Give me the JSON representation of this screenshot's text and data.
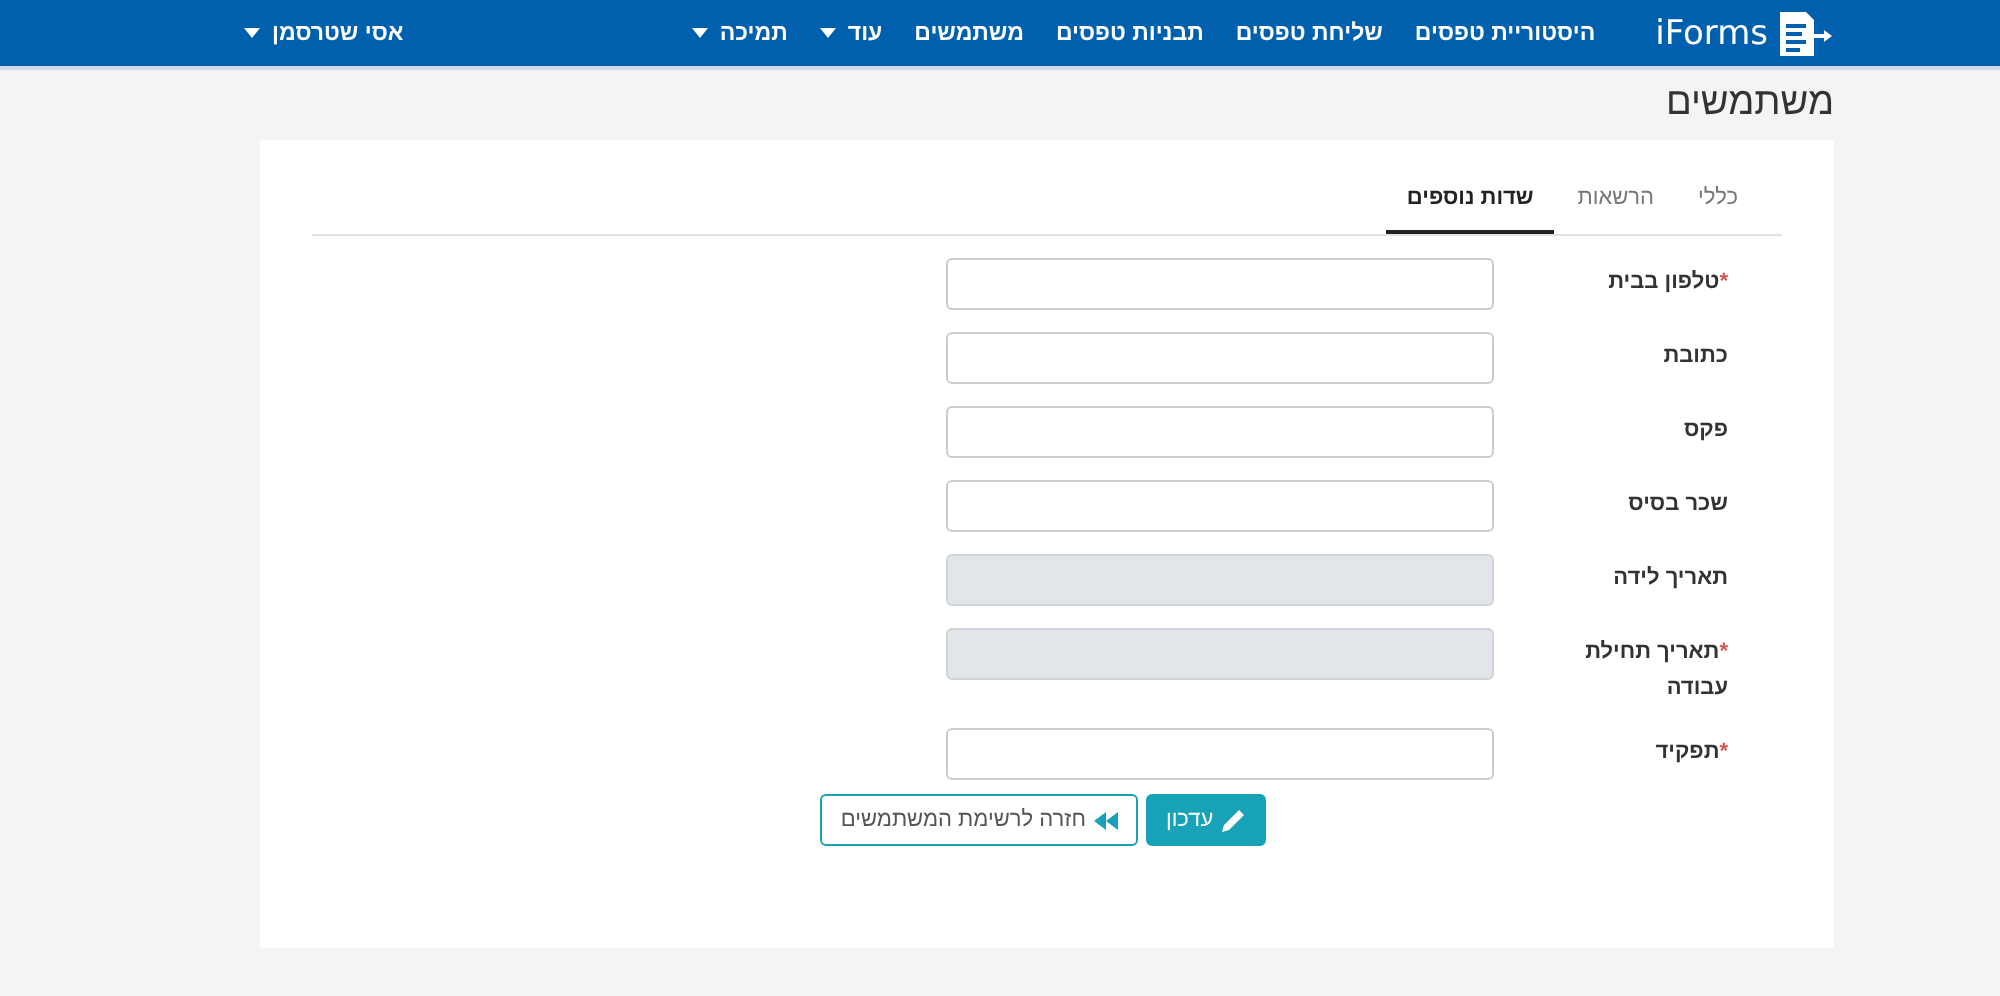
{
  "navbar": {
    "brand": "iForms",
    "items": [
      {
        "label": "היסטוריית טפסים",
        "dropdown": false
      },
      {
        "label": "שליחת טפסים",
        "dropdown": false
      },
      {
        "label": "תבניות טפסים",
        "dropdown": false
      },
      {
        "label": "משתמשים",
        "dropdown": false
      },
      {
        "label": "עוד",
        "dropdown": true
      },
      {
        "label": "תמיכה",
        "dropdown": true
      }
    ],
    "user": {
      "label": "אסי שטרסמן",
      "dropdown": true
    }
  },
  "page_title": "משתמשים",
  "tabs": [
    {
      "label": "כללי",
      "selected": false
    },
    {
      "label": "הרשאות",
      "selected": false
    },
    {
      "label": "שדות נוספים",
      "selected": true
    }
  ],
  "fields": [
    {
      "label": "טלפון בבית",
      "required_mark": "*",
      "disabled": false
    },
    {
      "label": "כתובת",
      "disabled": false
    },
    {
      "label": "פקס",
      "disabled": false
    },
    {
      "label": "שכר בסיס",
      "disabled": false
    },
    {
      "label": "תאריך לידה",
      "disabled": true
    },
    {
      "label": "תאריך תחילת עבודה",
      "required_mark": "*",
      "disabled": true
    },
    {
      "label": "תפקיד",
      "required_mark": "*",
      "disabled": false
    }
  ],
  "buttons": [
    {
      "label": "עדכון",
      "kind": "primary"
    },
    {
      "label": "חזרה לרשימת המשתמשים",
      "kind": "outline"
    }
  ]
}
